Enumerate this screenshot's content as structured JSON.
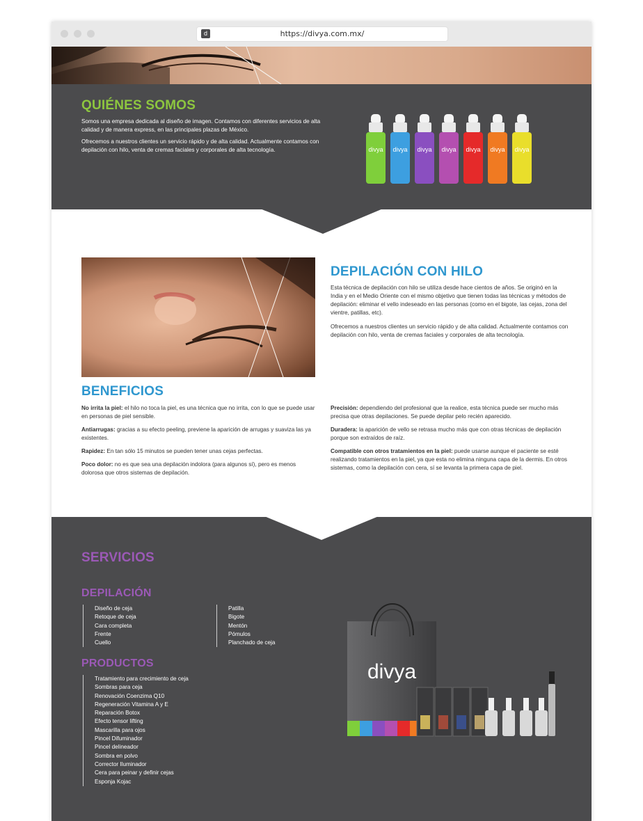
{
  "browser": {
    "url": "https://divya.com.mx/",
    "favicon": "d"
  },
  "about": {
    "title": "QUIÉNES SOMOS",
    "p1": "Somos una empresa dedicada al diseño de imagen. Contamos con diferentes servicios de alta calidad y de manera express, en las principales plazas de México.",
    "p2": "Ofrecemos a nuestros clientes un servicio rápido y de alta calidad. Actualmente contamos con depilación con hilo, venta de cremas faciales y corporales de alta tecnología.",
    "bottle_brand": "divya",
    "bottle_colors": [
      "#7fcf3b",
      "#3d9fe0",
      "#8a4fc0",
      "#b44fb0",
      "#e52a2a",
      "#f07a22",
      "#e9de2b"
    ]
  },
  "threading": {
    "title": "DEPILACIÓN CON HILO",
    "p1": "Esta técnica de depilación con hilo se utiliza desde hace cientos de años. Se originó en la India y en el Medio Oriente con el mismo objetivo que tienen todas las técnicas y métodos de depilación: eliminar el vello indeseado en las personas (como en el bigote, las cejas, zona del vientre, patillas, etc).",
    "p2": "Ofrecemos a nuestros clientes un servicio rápido y de alta calidad. Actualmente contamos con depilación con hilo, venta de cremas faciales y corporales de alta tecnología."
  },
  "benefits": {
    "title": "BENEFICIOS",
    "left": [
      {
        "term": "No irrita la piel:",
        "text": " el hilo no toca la piel, es una técnica que no irrita, con lo que se puede usar en personas de piel sensible."
      },
      {
        "term": "Antiarrugas:",
        "text": " gracias a su efecto peeling, previene la aparición de arrugas y suaviza las ya existentes."
      },
      {
        "term": "Rapidez:",
        "text": " En tan sólo 15 minutos se pueden tener unas cejas perfectas."
      },
      {
        "term": "Poco dolor:",
        "text": " no es que sea una depilación indolora (para algunos sí), pero es menos dolorosa que otros sistemas de depilación."
      }
    ],
    "right": [
      {
        "term": "Precisión:",
        "text": " dependiendo del profesional que la realice, esta técnica puede ser mucho más precisa que otras depilaciones. Se puede depilar pelo recién aparecido."
      },
      {
        "term": "Duradera:",
        "text": " la aparición de vello se retrasa mucho más que con otras técnicas de depilación porque son extraídos de raíz."
      },
      {
        "term": "Compatible con otros tratamientos en la piel:",
        "text": " puede usarse aunque el paciente se esté realizando tratamientos en la piel, ya que esta no elimina ninguna capa de la dermis. En otros sistemas, como la depilación con cera, sí se levanta la primera capa de piel."
      }
    ]
  },
  "services": {
    "title": "SERVICIOS",
    "depilation_title": "DEPILACIÓN",
    "depilation_col1": [
      "Diseño de ceja",
      "Retoque de ceja",
      "Cara completa",
      "Frente",
      "Cuello"
    ],
    "depilation_col2": [
      "Patilla",
      "Bigote",
      "Mentón",
      "Pómulos",
      "Planchado de ceja"
    ],
    "products_title": "PRODUCTOS",
    "products": [
      "Tratamiento para crecimiento de ceja",
      "Sombras para ceja",
      "Renovación Coenzima Q10",
      "Regeneración Vitamina A y E",
      "Reparación Botox",
      "Efecto tensor lifting",
      "Mascarilla para ojos",
      "Pincel Difuminador",
      "Pincel delineador",
      "Sombra en polvo",
      "Corrector Iluminador",
      "Cera para peinar y definir cejas",
      "Esponja Kojac"
    ],
    "bag_logo": "divya"
  },
  "colors": {
    "green": "#8dc63f",
    "blue": "#2f97cf",
    "purple": "#9b59b6",
    "dark": "#4b4b4d"
  }
}
